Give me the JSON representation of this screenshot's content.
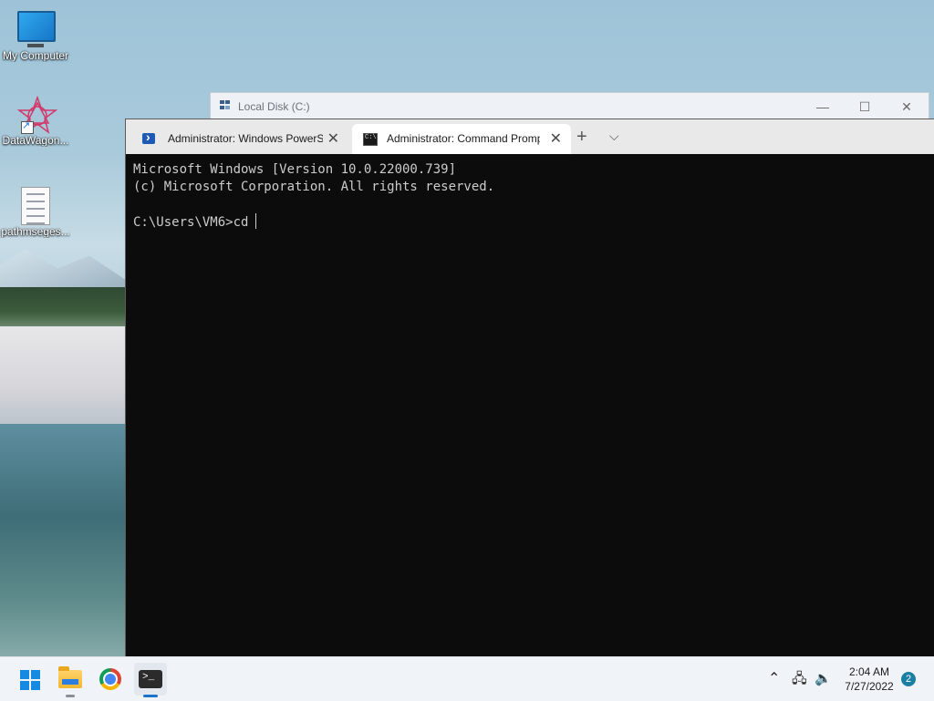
{
  "desktop": {
    "icons": [
      {
        "label": "My Computer",
        "icon": "monitor-icon"
      },
      {
        "label": "DataWagon...",
        "icon": "datawagon-icon"
      },
      {
        "label": "pathmseges...",
        "icon": "document-icon"
      }
    ]
  },
  "explorer_window": {
    "title": "Local Disk (C:)",
    "controls": {
      "minimize": "—",
      "maximize": "☐",
      "close": "✕"
    }
  },
  "terminal": {
    "tabs": [
      {
        "label": "Administrator: Windows PowerShell",
        "icon": "powershell-icon",
        "close": "✕",
        "active": false
      },
      {
        "label": "Administrator: Command Prompt",
        "icon": "cmd-icon",
        "close": "✕",
        "active": true
      }
    ],
    "new_tab": "+",
    "dropdown": "⌵",
    "console_lines": [
      "Microsoft Windows [Version 10.0.22000.739]",
      "(c) Microsoft Corporation. All rights reserved.",
      "",
      "C:\\Users\\VM6>cd"
    ]
  },
  "taskbar": {
    "apps": [
      "start-icon",
      "file-explorer-icon",
      "chrome-icon",
      "terminal-icon"
    ],
    "tray": {
      "chevron": "⌃",
      "network": "🖧",
      "volume": "🔈",
      "time": "2:04 AM",
      "date": "7/27/2022",
      "notifications": "2"
    }
  }
}
